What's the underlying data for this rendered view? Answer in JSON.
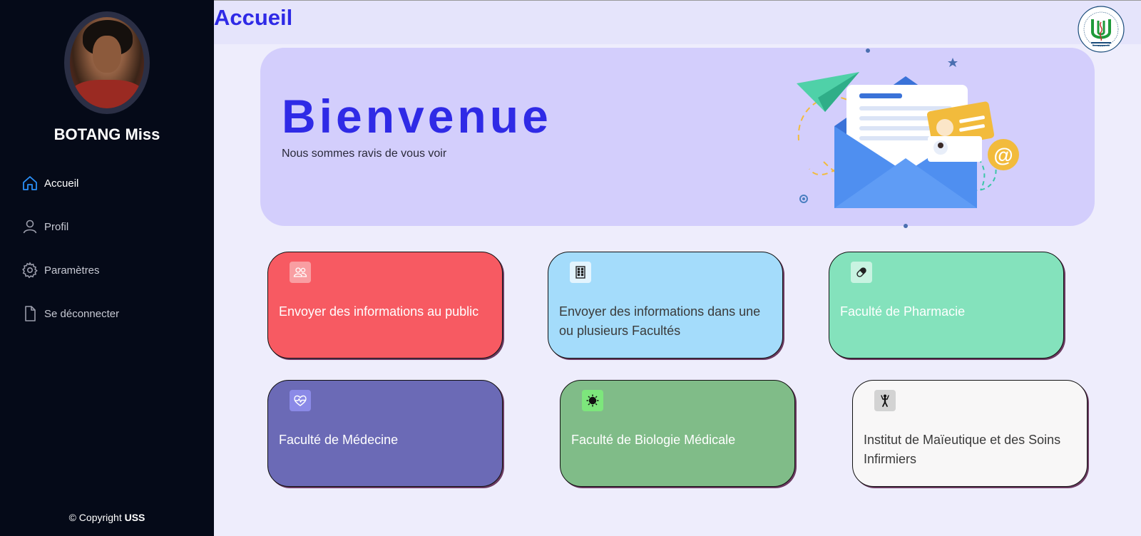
{
  "user": {
    "name": "BOTANG Miss"
  },
  "sidebar": {
    "items": [
      {
        "label": "Accueil",
        "icon": "home-icon",
        "active": true
      },
      {
        "label": "Profil",
        "icon": "user-icon",
        "active": false
      },
      {
        "label": "Paramètres",
        "icon": "gear-icon",
        "active": false
      },
      {
        "label": "Se déconnecter",
        "icon": "document-icon",
        "active": false
      }
    ]
  },
  "footer": {
    "copyright_prefix": "© Copyright",
    "copyright_brand": "USS"
  },
  "header": {
    "title": "Accueil",
    "logo": "university-logo-icon"
  },
  "banner": {
    "title": "Bienvenue",
    "subtitle": "Nous sommes ravis de vous voir",
    "illustration": "mail-envelope-illustration"
  },
  "cards": [
    {
      "label": "Envoyer des informations au public",
      "icon": "people-icon",
      "color": "#f75a62"
    },
    {
      "label": "Envoyer des informations dans une ou plusieurs Facultés",
      "icon": "building-icon",
      "color": "#a4dcfb"
    },
    {
      "label": "Faculté de Pharmacie",
      "icon": "pill-icon",
      "color": "#84e2bc"
    },
    {
      "label": "Faculté de Médecine",
      "icon": "heart-pulse-icon",
      "color": "#6b6ab6"
    },
    {
      "label": "Faculté de Biologie Médicale",
      "icon": "virus-icon",
      "color": "#80bc88"
    },
    {
      "label": "Institut de Maïeutique et des Soins Infirmiers",
      "icon": "person-icon",
      "color": "#f8f7f7"
    }
  ],
  "colors": {
    "accent": "#2f2ae6",
    "sidebar_bg": "#050a18",
    "banner_bg": "#d3cefc"
  }
}
